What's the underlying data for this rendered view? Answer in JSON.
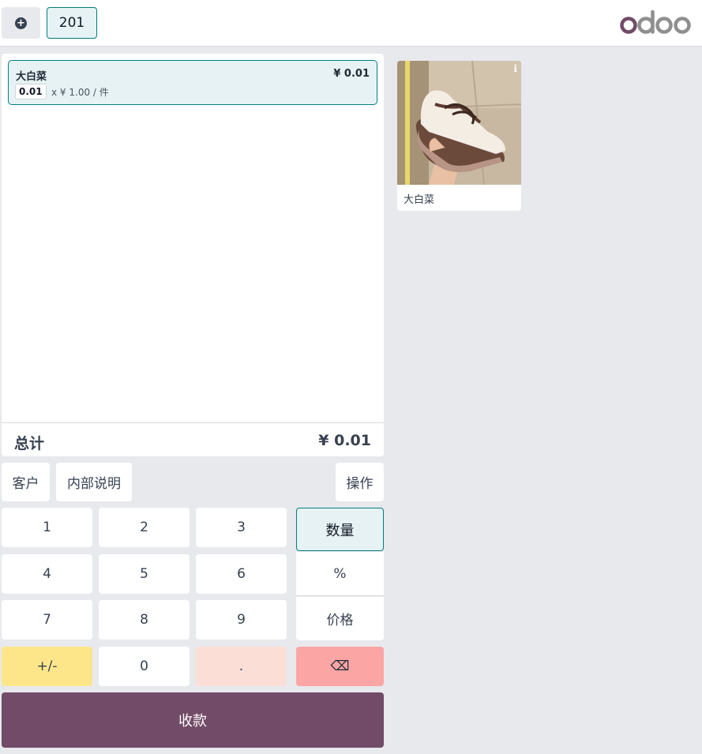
{
  "topbar": {
    "new_order_icon": "plus-circle-icon",
    "order_number": "201",
    "logo_text": "odoo"
  },
  "orderline": {
    "product_name": "大白菜",
    "price": "¥ 0.01",
    "quantity": "0.01",
    "unit_price": "x ¥ 1.00 / 件"
  },
  "totals": {
    "label": "总计",
    "value": "¥ 0.01"
  },
  "controls": {
    "customer": "客户",
    "internal_note": "内部说明",
    "actions": "操作"
  },
  "numpad": {
    "k1": "1",
    "k2": "2",
    "k3": "3",
    "k4": "4",
    "k5": "5",
    "k6": "6",
    "k7": "7",
    "k8": "8",
    "k9": "9",
    "plus_minus": "+/-",
    "k0": "0",
    "decimal": ".",
    "mode_qty": "数量",
    "mode_discount": "%",
    "mode_price": "价格",
    "backspace": "⌫"
  },
  "payment": {
    "label": "收款"
  },
  "products": [
    {
      "name": "大白菜",
      "info_icon": "info-icon"
    }
  ],
  "colors": {
    "brand": "#714b67",
    "accent_teal": "#017e84",
    "selected_bg": "#e6f2f3",
    "plus_minus_bg": "#fde68a",
    "decimal_bg": "#fbdfd7",
    "backspace_bg": "#fca5a5"
  }
}
